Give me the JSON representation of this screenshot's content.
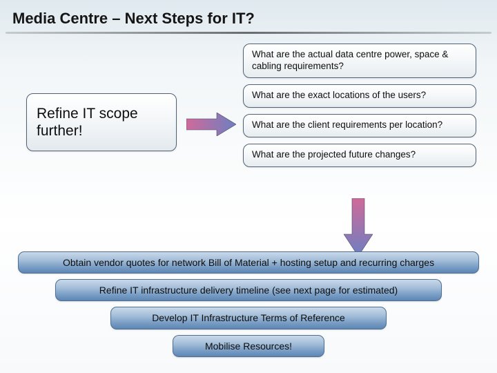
{
  "title": "Media Centre – Next Steps for IT?",
  "refine": "Refine IT scope further!",
  "questions": [
    "What are the actual data centre power, space & cabling requirements?",
    "What are the exact locations of the users?",
    "What are the client requirements per location?",
    "What are the projected future changes?"
  ],
  "bars": [
    "Obtain vendor quotes for network Bill of Material + hosting setup and recurring charges",
    "Refine  IT infrastructure delivery timeline (see next page for estimated)",
    "Develop IT Infrastructure Terms of Reference",
    "Mobilise Resources!"
  ]
}
